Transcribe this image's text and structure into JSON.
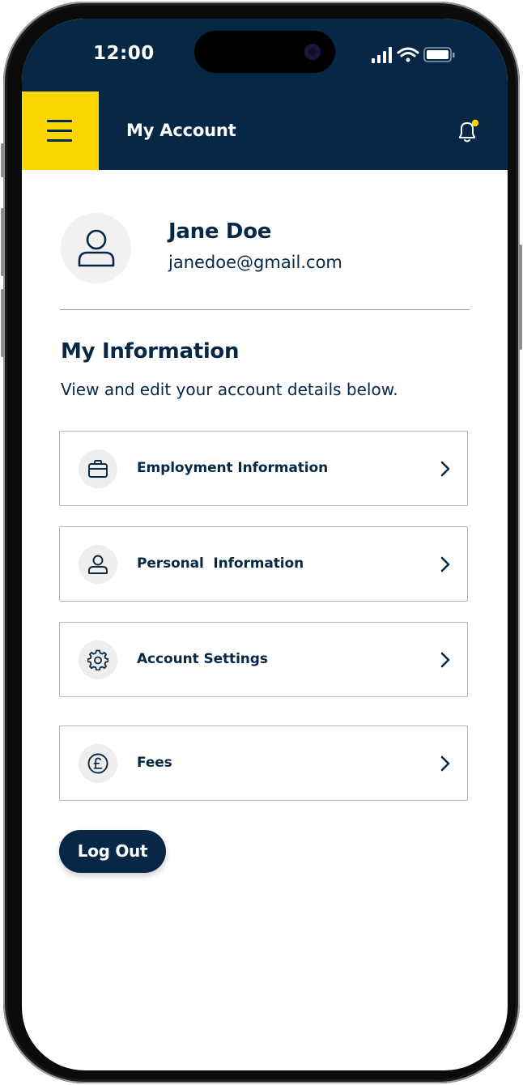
{
  "status_bar": {
    "time": "12:00",
    "icons": [
      "signal-icon",
      "wifi-icon",
      "battery-icon"
    ]
  },
  "header": {
    "menu_icon": "hamburger-menu-icon",
    "title": "My Account",
    "notification_icon": "bell-icon",
    "has_unread_notification": true
  },
  "profile": {
    "avatar_icon": "user-icon",
    "name": "Jane Doe",
    "email": "janedoe@gmail.com"
  },
  "section": {
    "title": "My Information",
    "subtitle": "View and edit your account details below."
  },
  "menu_items": [
    {
      "icon": "briefcase-icon",
      "label": "Employment Information"
    },
    {
      "icon": "user-icon",
      "label": "Personal  Information"
    },
    {
      "icon": "gear-icon",
      "label": "Account Settings"
    },
    {
      "icon": "pound-icon",
      "label": "Fees"
    }
  ],
  "logout_label": "Log Out",
  "colors": {
    "navy": "#062846",
    "accent_yellow": "#fdd600",
    "notification_dot": "#fdd600",
    "icon_circle_bg": "#eeeeee",
    "border": "#b5b5b5"
  }
}
